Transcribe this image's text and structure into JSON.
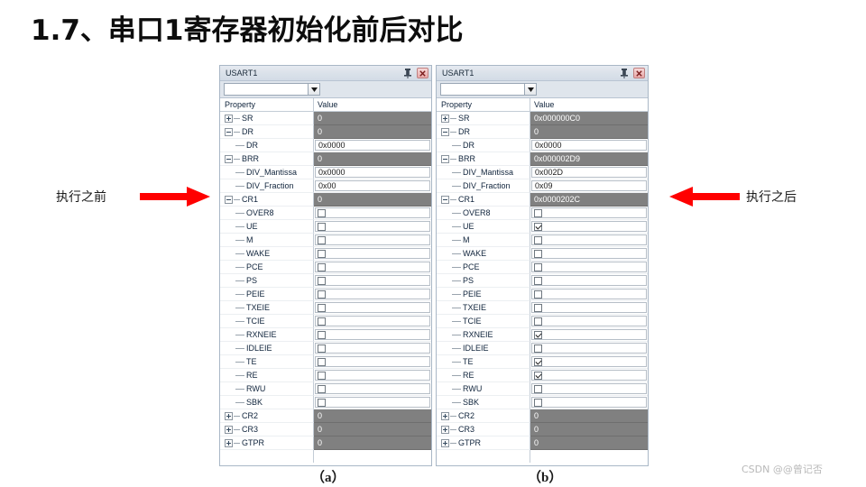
{
  "slide": {
    "title": "1.7、串口1寄存器初始化前后对比",
    "watermark": "CSDN @@曾记否"
  },
  "annotations": {
    "before": {
      "label": "执行之前",
      "arrow": "arrow-right-icon",
      "color": "#FF0000"
    },
    "after": {
      "label": "执行之后",
      "arrow": "arrow-left-icon",
      "color": "#FF0000"
    }
  },
  "panels": [
    {
      "id": "panel-a",
      "caption": "（a）",
      "titlebar": {
        "title": "USART1",
        "pin_icon": "pin-icon",
        "close_icon": "close-icon"
      },
      "combo": {
        "value": "",
        "placeholder": ""
      },
      "columns": {
        "property": "Property",
        "value": "Value"
      },
      "rows": [
        {
          "name": "SR",
          "level": 0,
          "expander": "plus",
          "type": "group",
          "value": "0"
        },
        {
          "name": "DR",
          "level": 0,
          "expander": "minus",
          "type": "group",
          "value": "0"
        },
        {
          "name": "DR",
          "level": 1,
          "expander": "none",
          "type": "text",
          "value": "0x0000"
        },
        {
          "name": "BRR",
          "level": 0,
          "expander": "minus",
          "type": "group",
          "value": "0"
        },
        {
          "name": "DIV_Mantissa",
          "level": 1,
          "expander": "none",
          "type": "text",
          "value": "0x0000"
        },
        {
          "name": "DIV_Fraction",
          "level": 1,
          "expander": "none",
          "type": "text",
          "value": "0x00"
        },
        {
          "name": "CR1",
          "level": 0,
          "expander": "minus",
          "type": "group",
          "value": "0"
        },
        {
          "name": "OVER8",
          "level": 1,
          "expander": "none",
          "type": "check",
          "checked": false
        },
        {
          "name": "UE",
          "level": 1,
          "expander": "none",
          "type": "check",
          "checked": false
        },
        {
          "name": "M",
          "level": 1,
          "expander": "none",
          "type": "check",
          "checked": false
        },
        {
          "name": "WAKE",
          "level": 1,
          "expander": "none",
          "type": "check",
          "checked": false
        },
        {
          "name": "PCE",
          "level": 1,
          "expander": "none",
          "type": "check",
          "checked": false
        },
        {
          "name": "PS",
          "level": 1,
          "expander": "none",
          "type": "check",
          "checked": false
        },
        {
          "name": "PEIE",
          "level": 1,
          "expander": "none",
          "type": "check",
          "checked": false
        },
        {
          "name": "TXEIE",
          "level": 1,
          "expander": "none",
          "type": "check",
          "checked": false
        },
        {
          "name": "TCIE",
          "level": 1,
          "expander": "none",
          "type": "check",
          "checked": false
        },
        {
          "name": "RXNEIE",
          "level": 1,
          "expander": "none",
          "type": "check",
          "checked": false
        },
        {
          "name": "IDLEIE",
          "level": 1,
          "expander": "none",
          "type": "check",
          "checked": false
        },
        {
          "name": "TE",
          "level": 1,
          "expander": "none",
          "type": "check",
          "checked": false
        },
        {
          "name": "RE",
          "level": 1,
          "expander": "none",
          "type": "check",
          "checked": false
        },
        {
          "name": "RWU",
          "level": 1,
          "expander": "none",
          "type": "check",
          "checked": false
        },
        {
          "name": "SBK",
          "level": 1,
          "expander": "none",
          "type": "check",
          "checked": false
        },
        {
          "name": "CR2",
          "level": 0,
          "expander": "plus",
          "type": "group",
          "value": "0"
        },
        {
          "name": "CR3",
          "level": 0,
          "expander": "plus",
          "type": "group",
          "value": "0"
        },
        {
          "name": "GTPR",
          "level": 0,
          "expander": "plus",
          "type": "group",
          "value": "0"
        }
      ]
    },
    {
      "id": "panel-b",
      "caption": "（b）",
      "titlebar": {
        "title": "USART1",
        "pin_icon": "pin-icon",
        "close_icon": "close-icon"
      },
      "combo": {
        "value": "",
        "placeholder": ""
      },
      "columns": {
        "property": "Property",
        "value": "Value"
      },
      "rows": [
        {
          "name": "SR",
          "level": 0,
          "expander": "plus",
          "type": "group",
          "value": "0x000000C0"
        },
        {
          "name": "DR",
          "level": 0,
          "expander": "minus",
          "type": "group",
          "value": "0"
        },
        {
          "name": "DR",
          "level": 1,
          "expander": "none",
          "type": "text",
          "value": "0x0000"
        },
        {
          "name": "BRR",
          "level": 0,
          "expander": "minus",
          "type": "group",
          "value": "0x000002D9"
        },
        {
          "name": "DIV_Mantissa",
          "level": 1,
          "expander": "none",
          "type": "text",
          "value": "0x002D"
        },
        {
          "name": "DIV_Fraction",
          "level": 1,
          "expander": "none",
          "type": "text",
          "value": "0x09"
        },
        {
          "name": "CR1",
          "level": 0,
          "expander": "minus",
          "type": "group",
          "value": "0x0000202C"
        },
        {
          "name": "OVER8",
          "level": 1,
          "expander": "none",
          "type": "check",
          "checked": false
        },
        {
          "name": "UE",
          "level": 1,
          "expander": "none",
          "type": "check",
          "checked": true
        },
        {
          "name": "M",
          "level": 1,
          "expander": "none",
          "type": "check",
          "checked": false
        },
        {
          "name": "WAKE",
          "level": 1,
          "expander": "none",
          "type": "check",
          "checked": false
        },
        {
          "name": "PCE",
          "level": 1,
          "expander": "none",
          "type": "check",
          "checked": false
        },
        {
          "name": "PS",
          "level": 1,
          "expander": "none",
          "type": "check",
          "checked": false
        },
        {
          "name": "PEIE",
          "level": 1,
          "expander": "none",
          "type": "check",
          "checked": false
        },
        {
          "name": "TXEIE",
          "level": 1,
          "expander": "none",
          "type": "check",
          "checked": false
        },
        {
          "name": "TCIE",
          "level": 1,
          "expander": "none",
          "type": "check",
          "checked": false
        },
        {
          "name": "RXNEIE",
          "level": 1,
          "expander": "none",
          "type": "check",
          "checked": true
        },
        {
          "name": "IDLEIE",
          "level": 1,
          "expander": "none",
          "type": "check",
          "checked": false
        },
        {
          "name": "TE",
          "level": 1,
          "expander": "none",
          "type": "check",
          "checked": true
        },
        {
          "name": "RE",
          "level": 1,
          "expander": "none",
          "type": "check",
          "checked": true
        },
        {
          "name": "RWU",
          "level": 1,
          "expander": "none",
          "type": "check",
          "checked": false
        },
        {
          "name": "SBK",
          "level": 1,
          "expander": "none",
          "type": "check",
          "checked": false
        },
        {
          "name": "CR2",
          "level": 0,
          "expander": "plus",
          "type": "group",
          "value": "0"
        },
        {
          "name": "CR3",
          "level": 0,
          "expander": "plus",
          "type": "group",
          "value": "0"
        },
        {
          "name": "GTPR",
          "level": 0,
          "expander": "plus",
          "type": "group",
          "value": "0"
        }
      ]
    }
  ]
}
